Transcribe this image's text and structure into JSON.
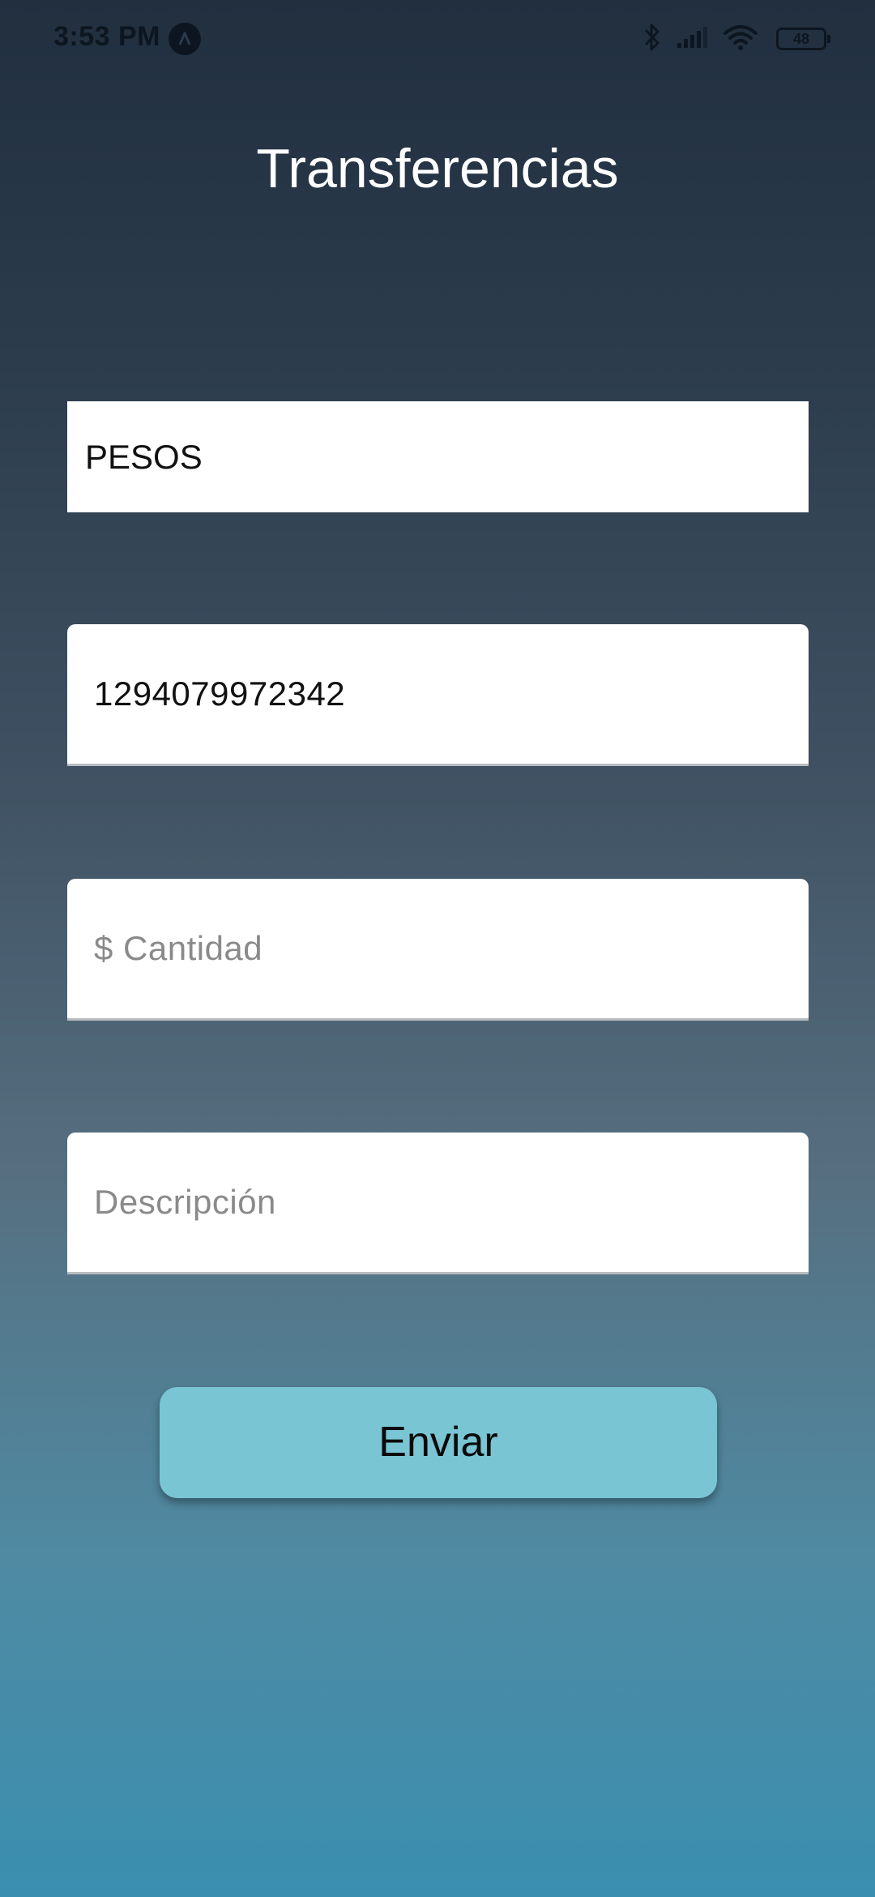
{
  "status_bar": {
    "time": "3:53 PM",
    "battery": "48"
  },
  "title": "Transferencias",
  "form": {
    "currency": "PESOS",
    "account_value": "1294079972342",
    "amount_placeholder": "$ Cantidad",
    "description_placeholder": "Descripción",
    "submit_label": "Enviar"
  },
  "colors": {
    "button": "#79c5d4",
    "background_top": "#212f3f",
    "background_bottom": "#3a8fb0"
  }
}
